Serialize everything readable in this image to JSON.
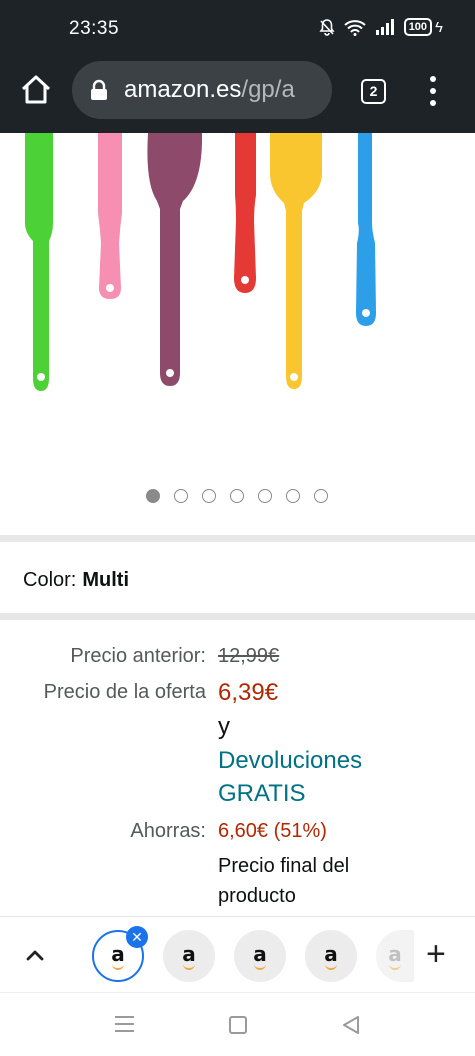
{
  "status_bar": {
    "time": "23:35",
    "battery": "100"
  },
  "browser": {
    "url_host": "amazon.es",
    "url_path": "/gp/a",
    "tab_count": "2"
  },
  "carousel": {
    "total": 7,
    "active_index": 0
  },
  "product": {
    "color_label": "Color:",
    "color_value": "Multi",
    "prev_price_label": "Precio anterior:",
    "prev_price": "12,99€",
    "deal_label": "Precio de la oferta",
    "deal_price": "6,39€",
    "and_word": "y",
    "returns_line1": "Devoluciones",
    "returns_line2": "GRATIS",
    "saving_label": "Ahorras:",
    "saving_value": "6,60€ (51%)",
    "final_line1": "Precio final del",
    "final_line2": "producto"
  },
  "tab_strip": {
    "tabs": [
      "a",
      "a",
      "a",
      "a",
      "a"
    ],
    "close_glyph": "✕",
    "new_tab_glyph": "+"
  },
  "colors": {
    "deal_red": "#b12704",
    "link_teal": "#007185",
    "spatula_colors": [
      "#4cd137",
      "#f78fb3",
      "#8e4a6b",
      "#e53935",
      "#f9c62f",
      "#2d9ee8"
    ]
  }
}
